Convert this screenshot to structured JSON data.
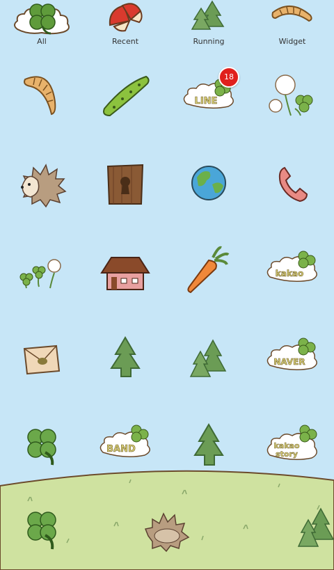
{
  "tabs": [
    {
      "label": "All",
      "icon": "clover-cloud-icon"
    },
    {
      "label": "Recent",
      "icon": "apple-slices-icon"
    },
    {
      "label": "Running",
      "icon": "trees-icon"
    },
    {
      "label": "Widget",
      "icon": "worm-icon"
    }
  ],
  "badge": {
    "count": "18"
  },
  "apps": [
    {
      "id": "worm",
      "icon": "worm-icon"
    },
    {
      "id": "cucumber",
      "icon": "cucumber-icon"
    },
    {
      "id": "line",
      "icon": "line-cloud-icon",
      "text": "LINE"
    },
    {
      "id": "clover-flower",
      "icon": "clover-flower-icon"
    },
    {
      "id": "hedgehog",
      "icon": "hedgehog-icon"
    },
    {
      "id": "wood-lock",
      "icon": "keyhole-wood-icon"
    },
    {
      "id": "globe",
      "icon": "globe-icon"
    },
    {
      "id": "phone",
      "icon": "phone-icon"
    },
    {
      "id": "flowers",
      "icon": "flowers-icon"
    },
    {
      "id": "house",
      "icon": "house-icon"
    },
    {
      "id": "carrot",
      "icon": "carrot-icon"
    },
    {
      "id": "kakao",
      "icon": "kakao-cloud-icon",
      "text": "kakao"
    },
    {
      "id": "envelope",
      "icon": "envelope-icon"
    },
    {
      "id": "tree",
      "icon": "tree-icon"
    },
    {
      "id": "trees",
      "icon": "trees-icon"
    },
    {
      "id": "naver",
      "icon": "naver-cloud-icon",
      "text": "NAVER"
    },
    {
      "id": "clover",
      "icon": "clover-icon"
    },
    {
      "id": "band",
      "icon": "band-cloud-icon",
      "text": "BAND"
    },
    {
      "id": "tree-2",
      "icon": "tree-icon"
    },
    {
      "id": "kakaostory",
      "icon": "kakaostory-cloud-icon",
      "text1": "kakao",
      "text2": "story"
    }
  ],
  "dock": [
    {
      "id": "dock-clover",
      "icon": "clover-icon"
    },
    {
      "id": "dock-hedgehog",
      "icon": "hedgehog-icon"
    },
    {
      "id": "dock-trees",
      "icon": "trees-icon"
    }
  ],
  "colors": {
    "sky": "#c7e6f7",
    "grass": "#cfe2a0",
    "badge": "#e0201d"
  }
}
